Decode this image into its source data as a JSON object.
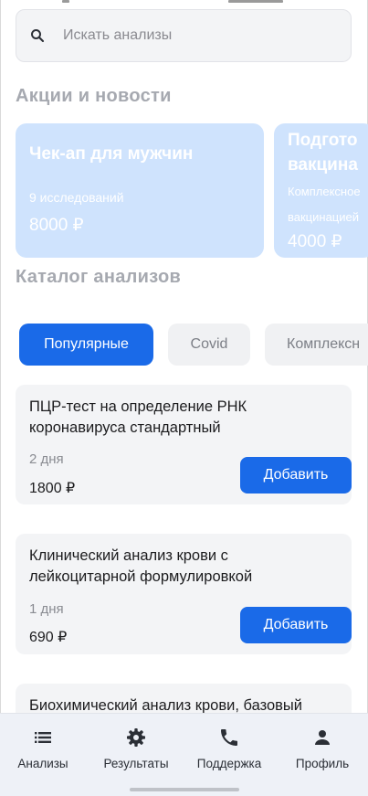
{
  "search": {
    "placeholder": "Искать анализы"
  },
  "promotions": {
    "title": "Акции и новости",
    "cards": [
      {
        "title": "Чек-ап для мужчин",
        "subtitle": "9 исследований",
        "price": "8000 ₽"
      },
      {
        "title_line1": "Подгото",
        "title_line2": "вакцина",
        "subtitle_line1": "Комплексное",
        "subtitle_line2": "вакцинацией",
        "price": "4000 ₽"
      }
    ]
  },
  "catalog": {
    "title": "Каталог анализов",
    "categories": [
      "Популярные",
      "Covid",
      "Комплексн"
    ],
    "active_category": "Популярные",
    "items": [
      {
        "name": "ПЦР-тест на определение РНК коронавируса стандартный",
        "duration": "2 дня",
        "price": "1800 ₽",
        "button": "Добавить"
      },
      {
        "name": "Клинический анализ крови с лейкоцитарной формулировкой",
        "duration": "1 дня",
        "price": "690 ₽",
        "button": "Добавить"
      },
      {
        "name": "Биохимический анализ крови, базовый"
      }
    ]
  },
  "bottom_nav": {
    "items": [
      {
        "label": "Анализы",
        "icon": "list-icon"
      },
      {
        "label": "Результаты",
        "icon": "gear-icon"
      },
      {
        "label": "Поддержка",
        "icon": "phone-icon"
      },
      {
        "label": "Профиль",
        "icon": "person-icon"
      }
    ]
  },
  "colors": {
    "accent": "#1a6ae8",
    "promo_card": "#cfe3fd",
    "section_title": "#a6a9b0",
    "card_bg": "#f3f4f6",
    "nav_bg": "#eef1f7"
  }
}
